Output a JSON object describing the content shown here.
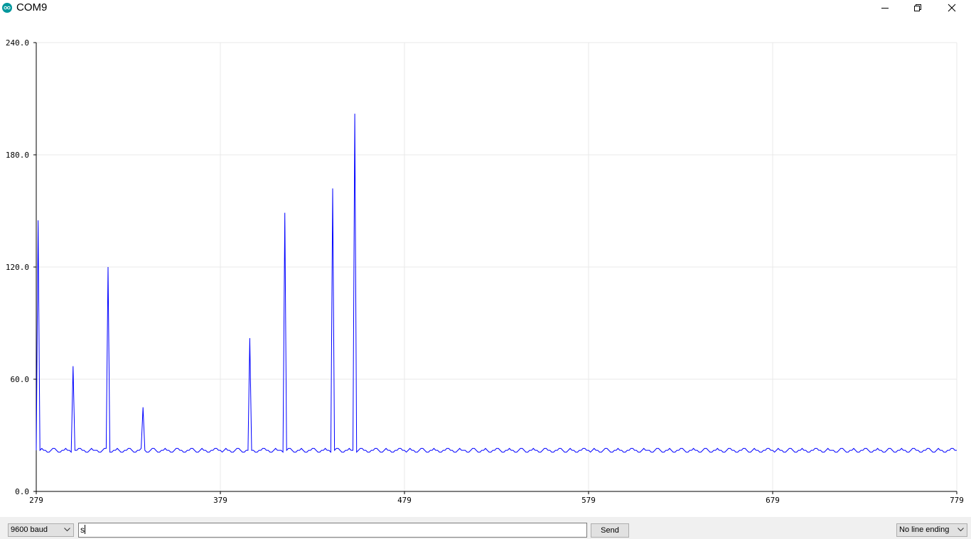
{
  "window": {
    "title": "COM9",
    "icon": "arduino-icon",
    "minimize_icon": "minimize-icon",
    "maximize_icon": "restore-icon",
    "close_icon": "close-icon"
  },
  "chart_data": {
    "type": "line",
    "title": "",
    "xlabel": "",
    "ylabel": "",
    "xlim": [
      279,
      779
    ],
    "ylim": [
      0,
      240
    ],
    "x_ticks": [
      "279",
      "379",
      "479",
      "579",
      "679",
      "779"
    ],
    "y_ticks": [
      "0.0",
      "60.0",
      "120.0",
      "180.0",
      "240.0"
    ],
    "grid": true,
    "line_color": "#0000ff",
    "series": [
      {
        "name": "",
        "x_start": 279,
        "step": 1,
        "spikes": [
          {
            "x": 280,
            "y": 145
          },
          {
            "x": 299,
            "y": 67
          },
          {
            "x": 318,
            "y": 120
          },
          {
            "x": 337,
            "y": 45
          },
          {
            "x": 395,
            "y": 82
          },
          {
            "x": 414,
            "y": 149
          },
          {
            "x": 440,
            "y": 162
          },
          {
            "x": 452,
            "y": 202
          }
        ],
        "baseline": [
          22,
          21,
          22,
          23,
          22,
          22,
          21,
          21,
          22,
          23,
          23,
          22,
          21,
          21,
          22,
          22,
          23,
          22,
          22,
          21,
          21,
          22,
          22,
          23,
          23,
          22,
          22,
          21,
          21,
          22,
          23,
          22,
          22,
          22,
          21,
          21,
          22,
          23,
          23,
          22,
          21,
          21,
          22,
          22,
          23,
          22,
          21,
          21,
          22,
          22,
          23,
          23,
          22,
          21,
          21,
          22,
          22,
          23,
          22,
          22,
          21,
          21,
          22,
          23,
          23,
          22,
          21,
          21,
          22,
          22,
          23,
          22,
          22,
          21,
          21,
          22,
          23,
          23,
          22,
          22,
          21,
          21,
          22,
          22,
          23,
          23,
          22,
          21,
          21,
          22,
          23,
          22,
          22,
          21,
          21,
          22,
          22,
          23,
          23,
          22
        ]
      }
    ]
  },
  "controls": {
    "baud": "9600 baud",
    "input_value": "s",
    "send_label": "Send",
    "line_ending": "No line ending",
    "dropdown_icon": "chevron-down-icon"
  }
}
